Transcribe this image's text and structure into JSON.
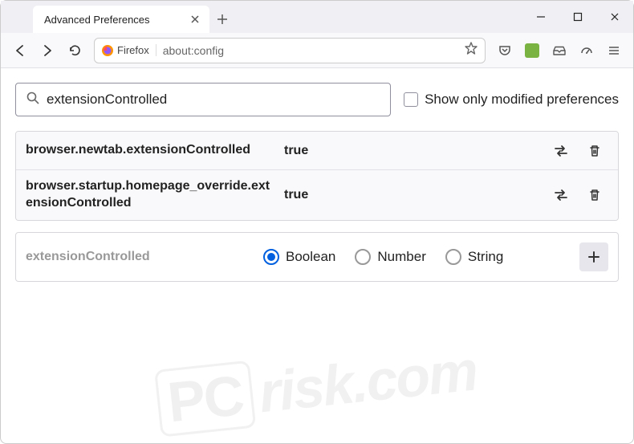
{
  "tab": {
    "title": "Advanced Preferences"
  },
  "address": {
    "label": "Firefox",
    "url": "about:config"
  },
  "search": {
    "value": "extensionControlled",
    "checkbox_label": "Show only modified preferences"
  },
  "prefs": [
    {
      "name": "browser.newtab.extensionControlled",
      "value": "true"
    },
    {
      "name": "browser.startup.homepage_override.extensionControlled",
      "value": "true"
    }
  ],
  "new_pref": {
    "name": "extensionControlled",
    "types": [
      "Boolean",
      "Number",
      "String"
    ],
    "selected": "Boolean"
  },
  "watermark": {
    "pc": "PC",
    "domain": "risk.com"
  }
}
